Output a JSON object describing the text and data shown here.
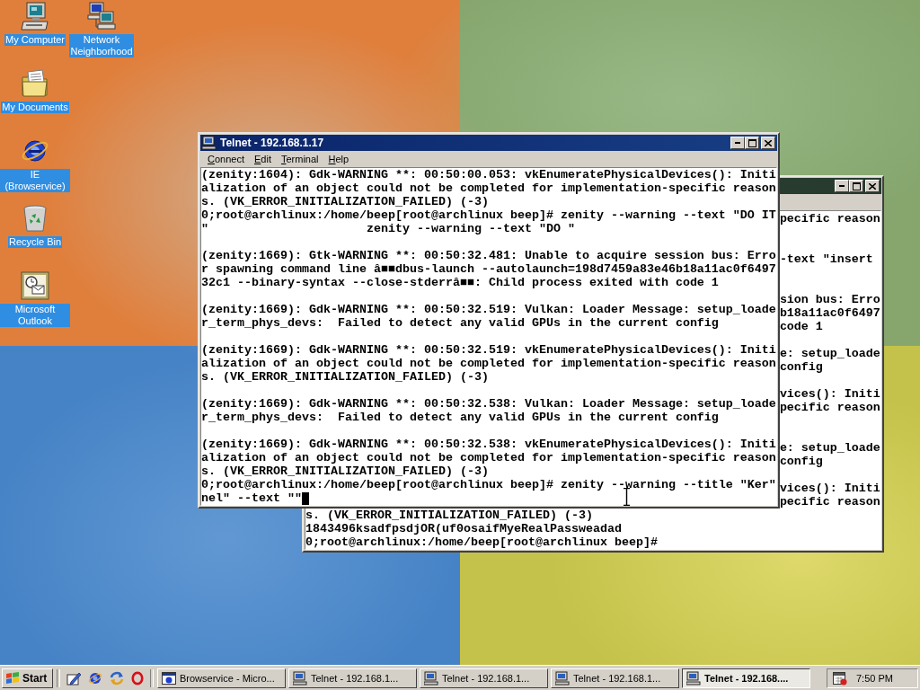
{
  "desktop_icons": [
    {
      "label": "My Computer",
      "kind": "computer"
    },
    {
      "label": "Network Neighborhood",
      "kind": "network"
    },
    {
      "label": "My Documents",
      "kind": "documents"
    },
    {
      "label": "IE (Browservice)",
      "kind": "browser"
    },
    {
      "label": "Recycle Bin",
      "kind": "recycle"
    },
    {
      "label": "Microsoft Outlook",
      "kind": "outlook"
    }
  ],
  "back_window": {
    "rows": [
      {
        "kind": "tail",
        "text": "pecific reason"
      },
      {
        "kind": "blank"
      },
      {
        "kind": "blank"
      },
      {
        "kind": "tail",
        "text": "-text \"insert"
      },
      {
        "kind": "blank"
      },
      {
        "kind": "blank"
      },
      {
        "kind": "tail",
        "text": "sion bus: Erro"
      },
      {
        "kind": "tail",
        "text": "b18a11ac0f6497"
      },
      {
        "kind": "tail",
        "text": "code 1"
      },
      {
        "kind": "blank"
      },
      {
        "kind": "tail",
        "text": "e: setup_loade"
      },
      {
        "kind": "tail",
        "text": "config"
      },
      {
        "kind": "blank"
      },
      {
        "kind": "tail",
        "text": "vices(): Initi"
      },
      {
        "kind": "tail",
        "text": "pecific reason"
      },
      {
        "kind": "blank"
      },
      {
        "kind": "blank"
      },
      {
        "kind": "tail",
        "text": "e: setup_loade"
      },
      {
        "kind": "tail",
        "text": "config"
      },
      {
        "kind": "blank"
      },
      {
        "kind": "tail",
        "text": "vices(): Initi"
      },
      {
        "kind": "tail",
        "text": "pecific reason"
      },
      {
        "kind": "line",
        "text": "s. (VK_ERROR_INITIALIZATION_FAILED) (-3)"
      },
      {
        "kind": "line",
        "text": "1843496ksadfpsdjOR(uf0osaifMyeRealPassweadad"
      },
      {
        "kind": "line",
        "text": "0;root@archlinux:/home/beep[root@archlinux beep]#"
      }
    ]
  },
  "front_window": {
    "title": "Telnet - 192.168.1.17",
    "menu": [
      "Connect",
      "Edit",
      "Terminal",
      "Help"
    ],
    "blocks": [
      {
        "lines": [
          "(zenity:1604): Gdk-WARNING **: 00:50:00.053: vkEnumeratePhysicalDevices(): Initi",
          "alization of an object could not be completed for implementation-specific reason",
          "s. (VK_ERROR_INITIALIZATION_FAILED) (-3)",
          "0;root@archlinux:/home/beep[root@archlinux beep]# zenity --warning --text \"DO IT",
          "\"                      zenity --warning --text \"DO \""
        ]
      },
      {
        "lines": [
          "(zenity:1669): Gtk-WARNING **: 00:50:32.481: Unable to acquire session bus: Erro",
          "r spawning command line â■■dbus-launch --autolaunch=198d7459a83e46b18a11ac0f6497",
          "32c1 --binary-syntax --close-stderrâ■■: Child process exited with code 1"
        ]
      },
      {
        "lines": [
          "(zenity:1669): Gdk-WARNING **: 00:50:32.519: Vulkan: Loader Message: setup_loade",
          "r_term_phys_devs:  Failed to detect any valid GPUs in the current config"
        ]
      },
      {
        "lines": [
          "(zenity:1669): Gdk-WARNING **: 00:50:32.519: vkEnumeratePhysicalDevices(): Initi",
          "alization of an object could not be completed for implementation-specific reason",
          "s. (VK_ERROR_INITIALIZATION_FAILED) (-3)"
        ]
      },
      {
        "lines": [
          "(zenity:1669): Gdk-WARNING **: 00:50:32.538: Vulkan: Loader Message: setup_loade",
          "r_term_phys_devs:  Failed to detect any valid GPUs in the current config"
        ]
      },
      {
        "lines": [
          "(zenity:1669): Gdk-WARNING **: 00:50:32.538: vkEnumeratePhysicalDevices(): Initi",
          "alization of an object could not be completed for implementation-specific reason",
          "s. (VK_ERROR_INITIALIZATION_FAILED) (-3)",
          "0;root@archlinux:/home/beep[root@archlinux beep]# zenity --warning --title \"Ker\"",
          "nel\" --text \"\""
        ]
      }
    ],
    "cursor": true
  },
  "taskbar": {
    "start": "Start",
    "tasks": [
      {
        "label": "Browservice - Micro...",
        "kind": "browser",
        "selected": false
      },
      {
        "label": "Telnet - 192.168.1...",
        "kind": "telnet",
        "selected": false
      },
      {
        "label": "Telnet - 192.168.1...",
        "kind": "telnet",
        "selected": false
      },
      {
        "label": "Telnet - 192.168.1...",
        "kind": "telnet",
        "selected": false
      },
      {
        "label": "Telnet - 192.168....",
        "kind": "telnet",
        "selected": true
      }
    ],
    "clock": "7:50 PM"
  }
}
